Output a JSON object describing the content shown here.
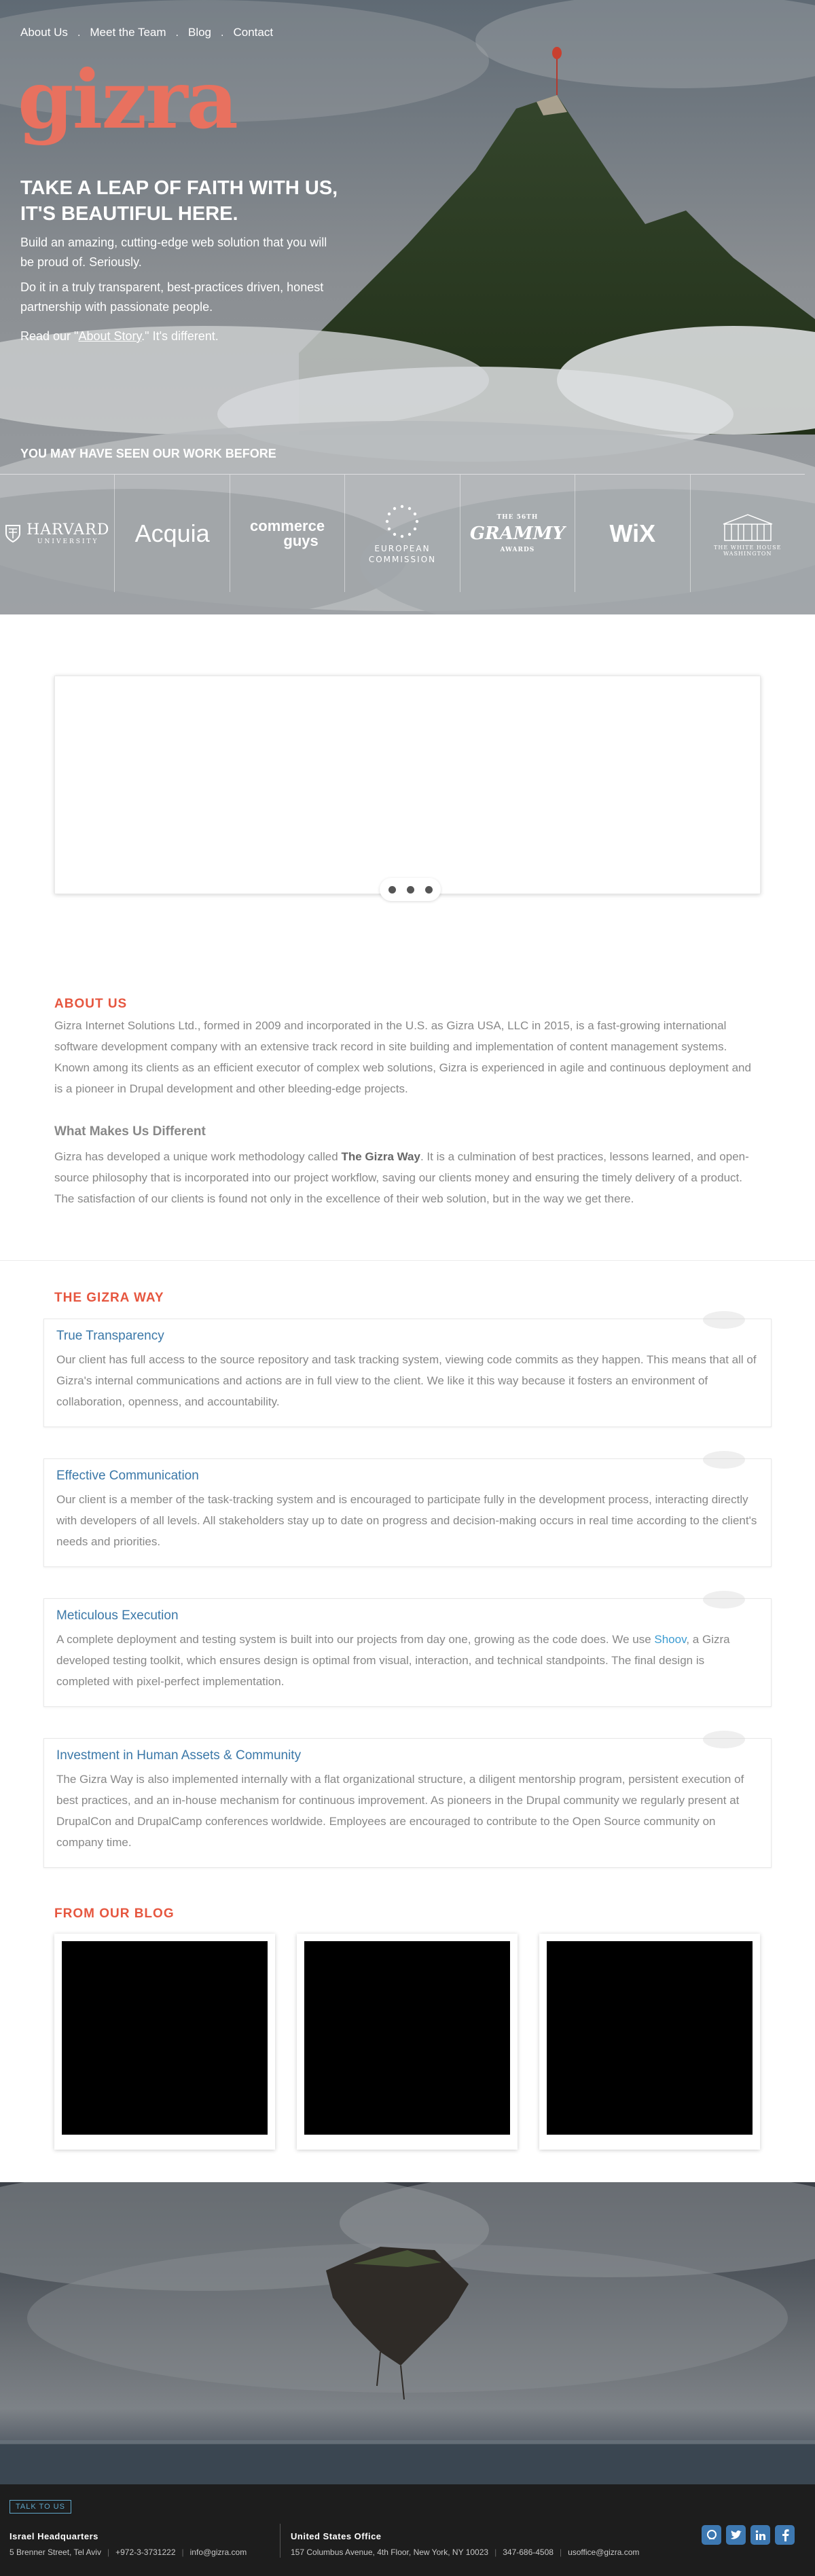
{
  "nav": [
    "About Us",
    "Meet the Team",
    "Blog",
    "Contact"
  ],
  "hero": {
    "logo": "gizra",
    "tagline_line1": "TAKE A LEAP OF FAITH WITH US,",
    "tagline_line2": "IT'S BEAUTIFUL HERE.",
    "p1": "Build an amazing, cutting-edge web solution that you will be proud of. Seriously.",
    "p2": "Do it in a truly transparent, best-practices driven, honest partnership with passionate people.",
    "p3_prefix": "Read our \"",
    "p3_link": "About Story",
    "p3_suffix": ".\" It's different.",
    "seen_title": "YOU MAY HAVE SEEN OUR WORK BEFORE"
  },
  "client_logos": {
    "harvard": "HARVARD",
    "harvard_sub": "UNIVERSITY",
    "acquia": "Acquia",
    "commerce_guys_1": "commerce",
    "commerce_guys_2": "guys",
    "ec_1": "EUROPEAN",
    "ec_2": "COMMISSION",
    "grammy_top": "THE 56TH",
    "grammy": "GRAMMY",
    "grammy_sub": "AWARDS",
    "wix": "WiX",
    "white_house": "THE WHITE HOUSE",
    "white_house_sub": "WASHINGTON"
  },
  "about": {
    "title": "ABOUT US",
    "p1": "Gizra Internet Solutions Ltd., formed in 2009 and incorporated in the U.S. as Gizra USA, LLC in 2015, is a fast-growing international software development company with an extensive track record in site building and implementation of content management systems. Known among its clients as an efficient executor of complex web solutions, Gizra is experienced in agile and continuous deployment and is a pioneer in Drupal development and other bleeding-edge projects.",
    "subtitle": "What Makes Us Different",
    "p2_prefix": "Gizra has developed a unique work methodology called ",
    "p2_bold": "The Gizra Way",
    "p2_suffix": ". It is a culmination of best practices, lessons learned, and open-source philosophy that is incorporated into our project workflow, saving our clients money and ensuring the timely delivery of a product. The satisfaction of our clients is found not only in the excellence of their web solution, but in the way we get there."
  },
  "gizra_way": {
    "title": "THE GIZRA WAY",
    "cards": [
      {
        "title": "True Transparency",
        "text": "Our client has full access to the source repository and task tracking system, viewing code commits as they happen. This means that all of Gizra's internal communications and actions are in full view to the client. We like it this way because it fosters an environment of collaboration, openness, and accountability."
      },
      {
        "title": "Effective Communication",
        "text": "Our client is a member of the task-tracking system and is encouraged to participate fully in the development process, interacting directly with developers of all levels. All stakeholders stay up to date on progress and decision-making occurs in real time according to the client's needs and priorities."
      },
      {
        "title": "Meticulous Execution",
        "text_prefix": "A complete deployment and testing system is built into our projects from day one, growing as the code does. We use ",
        "link": "Shoov",
        "text_suffix": ", a Gizra developed testing toolkit, which ensures design is optimal from visual, interaction, and technical standpoints. The final design is completed with pixel-perfect implementation."
      },
      {
        "title": "Investment in Human Assets & Community",
        "text": "The Gizra Way is also implemented internally with a flat organizational structure, a diligent mentorship program, persistent execution of best practices, and an in-house mechanism for continuous improvement. As pioneers in the Drupal community we regularly present at DrupalCon and DrupalCamp conferences worldwide. Employees are encouraged to contribute to the Open Source community on company time."
      }
    ]
  },
  "blog": {
    "title": "FROM OUR BLOG"
  },
  "footer": {
    "talk": "TALK TO US",
    "israel_title": "Israel Headquarters",
    "israel_address": "5 Brenner Street, Tel Aviv",
    "israel_phone": "+972-3-3731222",
    "israel_email": "info@gizra.com",
    "us_title": "United States Office",
    "us_address": "157 Columbus Avenue, 4th Floor, New York, NY 10023",
    "us_phone": "347-686-4508",
    "us_email": "usoffice@gizra.com",
    "social": [
      "github-icon",
      "twitter-icon",
      "linkedin-icon",
      "facebook-icon"
    ]
  },
  "colors": {
    "accent": "#e8715f",
    "section_title": "#e6563f",
    "card_title": "#3b78a8",
    "social": "#3d78b1",
    "footer_bg": "#1d1d1d"
  }
}
